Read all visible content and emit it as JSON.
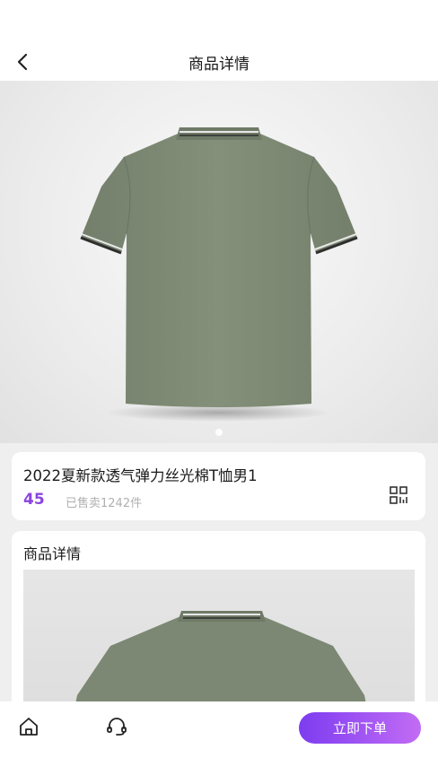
{
  "header": {
    "title": "商品详情",
    "back_icon": "chevron-left-icon"
  },
  "hero": {
    "carousel_total": 1,
    "carousel_active": 1
  },
  "product": {
    "name": "2022夏新款透气弹力丝光棉T恤男1",
    "price": "45",
    "sold": "已售卖1242件",
    "share_icon": "qrcode-icon"
  },
  "detail": {
    "title": "商品详情"
  },
  "bottom": {
    "home_icon": "home-icon",
    "service_icon": "headset-icon",
    "order_label": "立即下单"
  },
  "colors": {
    "accent": "#8b44e0",
    "button_start": "#7d3cf0",
    "button_end": "#c26cf5",
    "shirt": "#7e8a75"
  }
}
